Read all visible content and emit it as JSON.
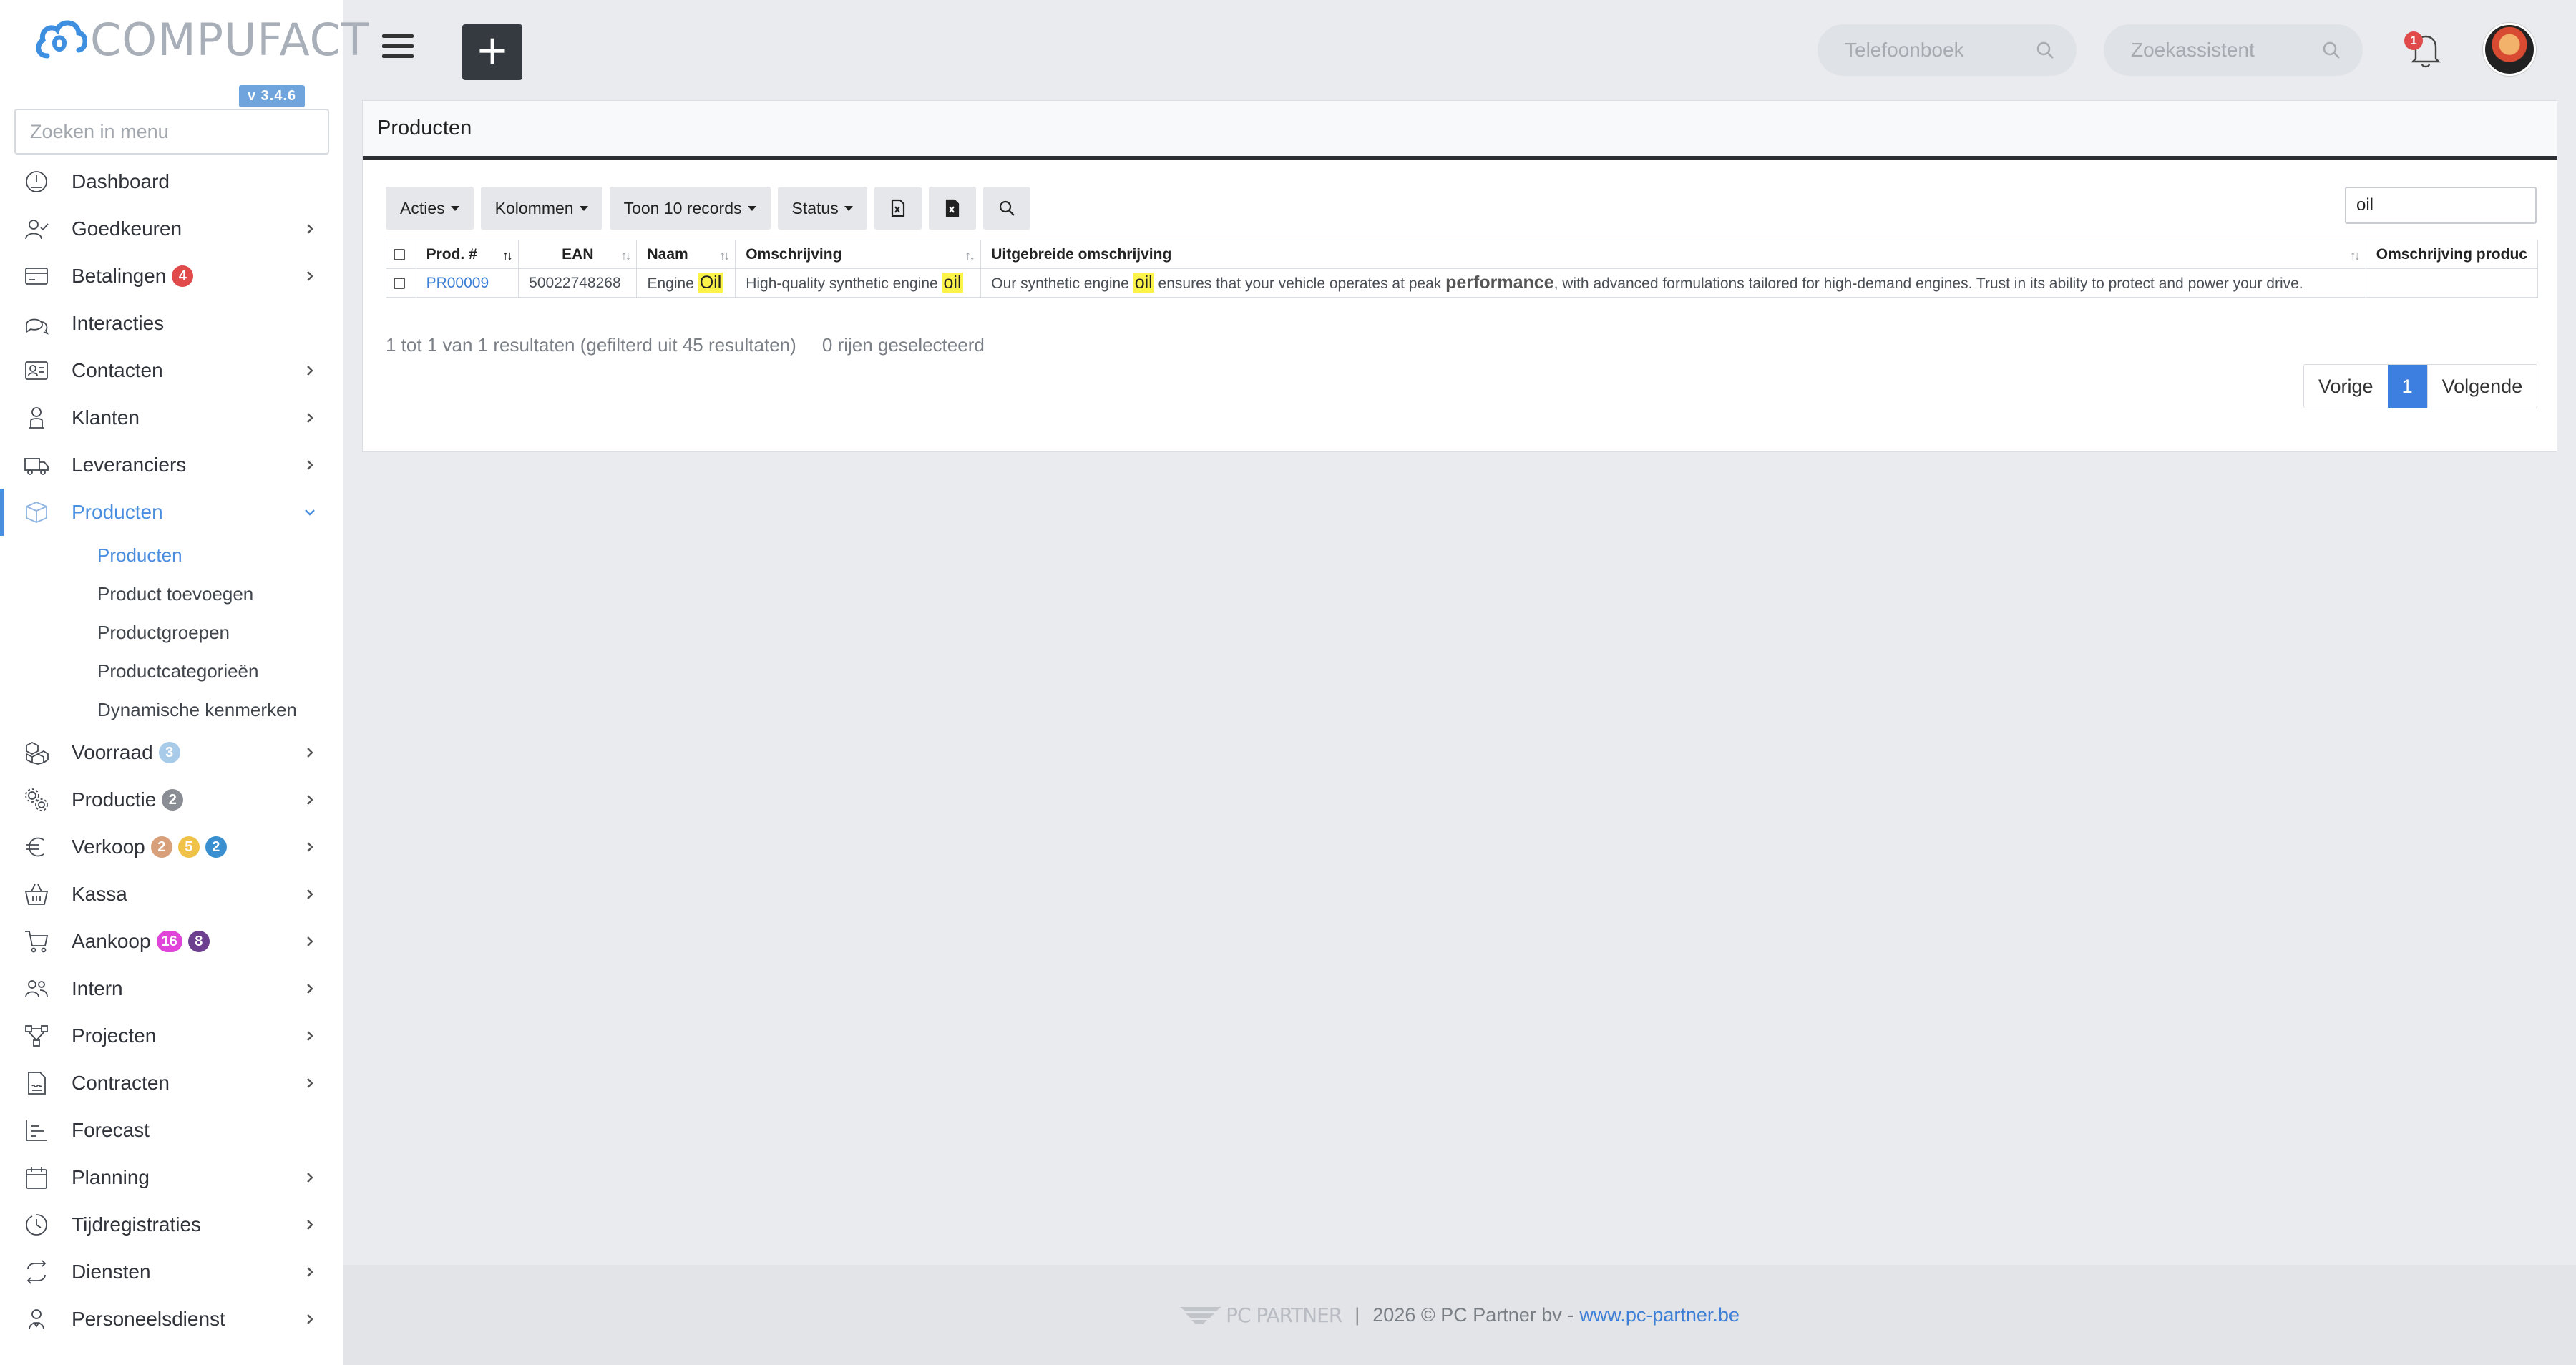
{
  "brand": {
    "name": "COMPUFACT",
    "version": "v 3.4.6"
  },
  "menu_search": {
    "placeholder": "Zoeken in menu"
  },
  "nav": [
    {
      "id": "dashboard",
      "label": "Dashboard",
      "icon": "dashboard-icon",
      "chevron": false
    },
    {
      "id": "goedkeuren",
      "label": "Goedkeuren",
      "icon": "user-check-icon",
      "chevron": true
    },
    {
      "id": "betalingen",
      "label": "Betalingen",
      "icon": "credit-card-icon",
      "chevron": true,
      "badges": [
        {
          "text": "4",
          "color": "#e04a4a"
        }
      ]
    },
    {
      "id": "interacties",
      "label": "Interacties",
      "icon": "chat-icon",
      "chevron": false
    },
    {
      "id": "contacten",
      "label": "Contacten",
      "icon": "contact-card-icon",
      "chevron": true
    },
    {
      "id": "klanten",
      "label": "Klanten",
      "icon": "customer-icon",
      "chevron": true
    },
    {
      "id": "leveranciers",
      "label": "Leveranciers",
      "icon": "truck-icon",
      "chevron": true
    },
    {
      "id": "producten",
      "label": "Producten",
      "icon": "box-icon",
      "chevron": true,
      "expanded": true,
      "active": true,
      "sub": [
        {
          "label": "Producten",
          "active": true
        },
        {
          "label": "Product toevoegen"
        },
        {
          "label": "Productgroepen"
        },
        {
          "label": "Productcategorieën"
        },
        {
          "label": "Dynamische kenmerken"
        }
      ]
    },
    {
      "id": "voorraad",
      "label": "Voorraad",
      "icon": "boxes-icon",
      "chevron": true,
      "badges": [
        {
          "text": "3",
          "color": "#a9cbea"
        }
      ]
    },
    {
      "id": "productie",
      "label": "Productie",
      "icon": "gears-icon",
      "chevron": true,
      "badges": [
        {
          "text": "2",
          "color": "#8a8e94"
        }
      ]
    },
    {
      "id": "verkoop",
      "label": "Verkoop",
      "icon": "euro-icon",
      "chevron": true,
      "badges": [
        {
          "text": "2",
          "color": "#d8a07a"
        },
        {
          "text": "5",
          "color": "#f1c24a"
        },
        {
          "text": "2",
          "color": "#3a8fd0"
        }
      ]
    },
    {
      "id": "kassa",
      "label": "Kassa",
      "icon": "basket-icon",
      "chevron": true
    },
    {
      "id": "aankoop",
      "label": "Aankoop",
      "icon": "cart-icon",
      "chevron": true,
      "badges": [
        {
          "text": "16",
          "color": "#e044d9"
        },
        {
          "text": "8",
          "color": "#6d3f8f"
        }
      ]
    },
    {
      "id": "intern",
      "label": "Intern",
      "icon": "team-icon",
      "chevron": true
    },
    {
      "id": "projecten",
      "label": "Projecten",
      "icon": "project-icon",
      "chevron": true
    },
    {
      "id": "contracten",
      "label": "Contracten",
      "icon": "contract-icon",
      "chevron": true
    },
    {
      "id": "forecast",
      "label": "Forecast",
      "icon": "forecast-chart-icon",
      "chevron": false
    },
    {
      "id": "planning",
      "label": "Planning",
      "icon": "calendar-icon",
      "chevron": true
    },
    {
      "id": "tijdregistraties",
      "label": "Tijdregistraties",
      "icon": "clock-icon",
      "chevron": true
    },
    {
      "id": "diensten",
      "label": "Diensten",
      "icon": "repeat-icon",
      "chevron": true
    },
    {
      "id": "personeelsdienst",
      "label": "Personeelsdienst",
      "icon": "staff-icon",
      "chevron": true
    }
  ],
  "topbar": {
    "add_label": "+",
    "phonebook_placeholder": "Telefoonboek",
    "assistant_placeholder": "Zoekassistent",
    "notification_count": "1"
  },
  "card": {
    "title": "Producten",
    "toolbar": {
      "acties": "Acties",
      "kolommen": "Kolommen",
      "toon": "Toon 10 records",
      "status": "Status"
    },
    "search_value": "oil",
    "columns": [
      "Prod. #",
      "EAN",
      "Naam",
      "Omschrijving",
      "Uitgebreide omschrijving",
      "Omschrijving produc"
    ],
    "rows": [
      {
        "prod": "PR00009",
        "ean": "50022748268",
        "naam_pre": "Engine ",
        "naam_hl": "Oil",
        "omschr_pre": "High-quality synthetic engine ",
        "omschr_hl": "oil",
        "uitgebr_pre": "Our synthetic engine ",
        "uitgebr_hl": "oil",
        "uitgebr_mid": " ensures that your vehicle operates at peak ",
        "uitgebr_strong": "performance",
        "uitgebr_post": ", with advanced formulations tailored for high-demand engines. Trust in its ability to protect and power your drive."
      }
    ],
    "info": "1 tot 1 van 1 resultaten (gefilterd uit 45 resultaten)",
    "selected": "0 rijen geselecteerd",
    "pager": {
      "prev": "Vorige",
      "current": "1",
      "next": "Volgende"
    }
  },
  "footer": {
    "logo_text": "PC PARTNER",
    "divider": "|",
    "copyright": "2026 © PC Partner bv -",
    "site": "www.pc-partner.be"
  }
}
